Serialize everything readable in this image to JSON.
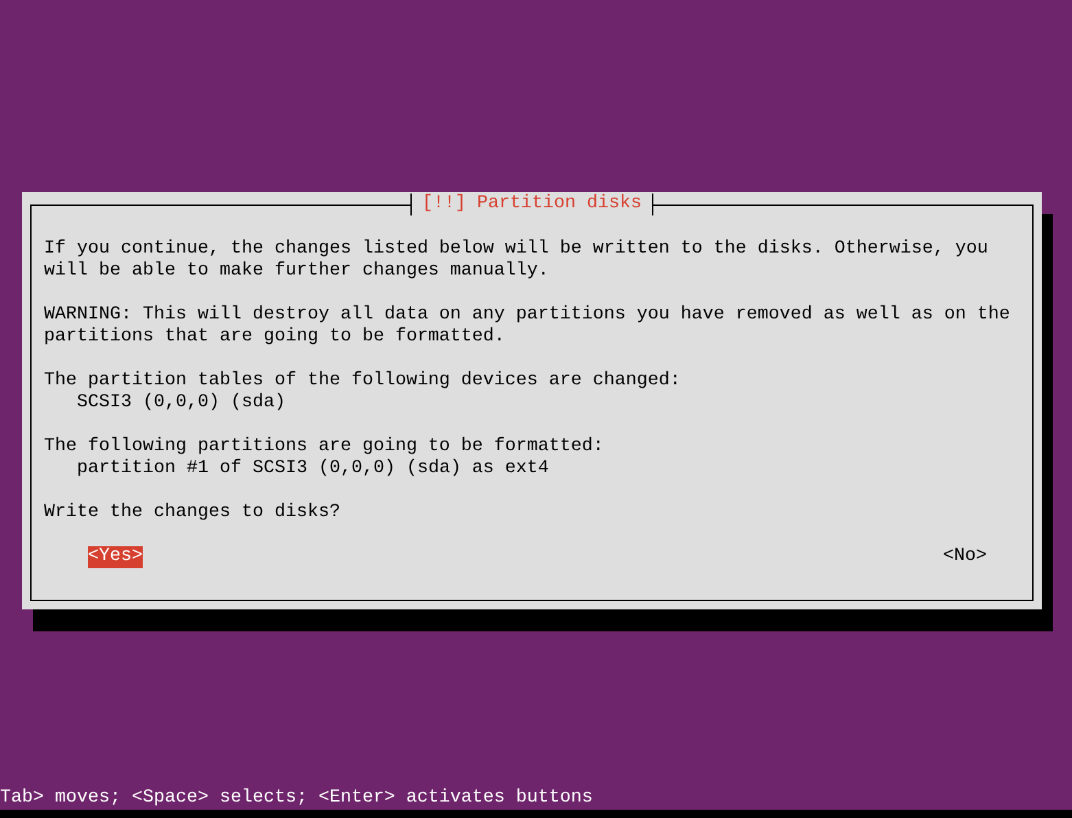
{
  "dialog": {
    "title": "[!!] Partition disks",
    "paragraphs": [
      {
        "text": "If you continue, the changes listed below will be written to the disks. Otherwise, you will be able to make further changes manually."
      },
      {
        "text": "WARNING: This will destroy all data on any partitions you have removed as well as on the partitions that are going to be formatted."
      },
      {
        "text": "The partition tables of the following devices are changed:",
        "items": [
          "SCSI3 (0,0,0) (sda)"
        ]
      },
      {
        "text": "The following partitions are going to be formatted:",
        "items": [
          "partition #1 of SCSI3 (0,0,0) (sda) as ext4"
        ]
      },
      {
        "text": "Write the changes to disks?"
      }
    ],
    "buttons": [
      {
        "label": "<Yes>",
        "selected": true
      },
      {
        "label": "<No>",
        "selected": false
      }
    ]
  },
  "status_bar": "Tab> moves; <Space> selects; <Enter> activates buttons"
}
